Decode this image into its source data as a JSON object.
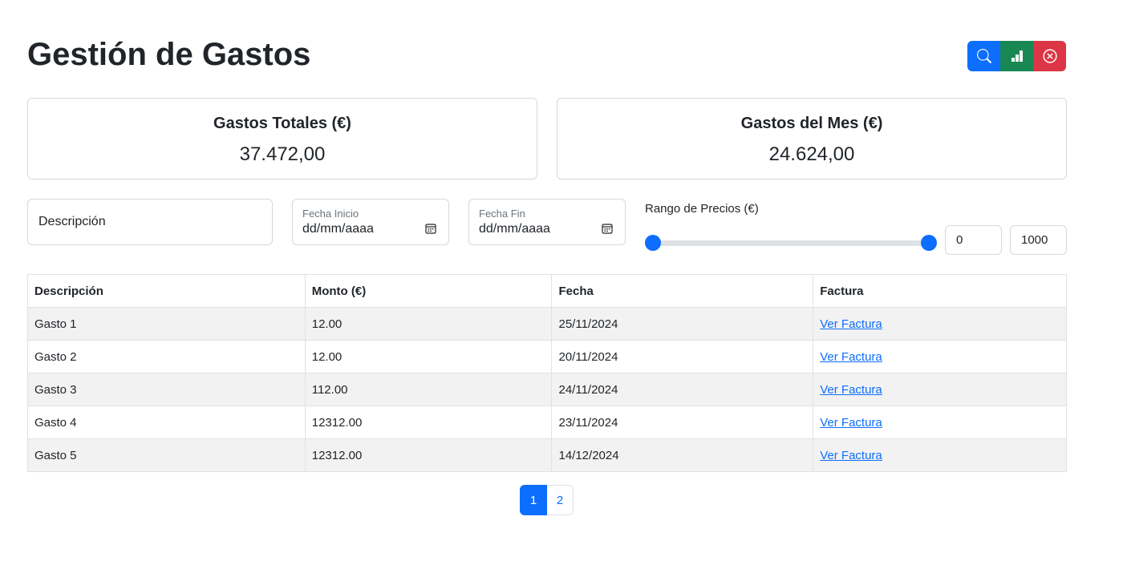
{
  "header": {
    "title": "Gestión de Gastos",
    "buttons": [
      {
        "icon": "search-icon",
        "color": "#0d6efd"
      },
      {
        "icon": "bar-chart-icon",
        "color": "#198754"
      },
      {
        "icon": "close-circle-icon",
        "color": "#dc3545"
      }
    ]
  },
  "summary": {
    "total": {
      "label": "Gastos Totales (€)",
      "value": "37.472,00"
    },
    "month": {
      "label": "Gastos del Mes (€)",
      "value": "24.624,00"
    }
  },
  "filters": {
    "description_placeholder": "Descripción",
    "start_date": {
      "label": "Fecha Inicio",
      "value": "dd/mm/aaaa"
    },
    "end_date": {
      "label": "Fecha Fin",
      "value": "dd/mm/aaaa"
    },
    "price_range": {
      "label": "Rango de Precios (€)",
      "min": "0",
      "max": "1000"
    }
  },
  "table": {
    "headers": [
      "Descripción",
      "Monto (€)",
      "Fecha",
      "Factura"
    ],
    "rows": [
      {
        "descripcion": "Gasto 1",
        "monto": "12.00",
        "fecha": "25/11/2024",
        "factura": "Ver Factura"
      },
      {
        "descripcion": "Gasto 2",
        "monto": "12.00",
        "fecha": "20/11/2024",
        "factura": "Ver Factura"
      },
      {
        "descripcion": "Gasto 3",
        "monto": "112.00",
        "fecha": "24/11/2024",
        "factura": "Ver Factura"
      },
      {
        "descripcion": "Gasto 4",
        "monto": "12312.00",
        "fecha": "23/11/2024",
        "factura": "Ver Factura"
      },
      {
        "descripcion": "Gasto 5",
        "monto": "12312.00",
        "fecha": "14/12/2024",
        "factura": "Ver Factura"
      }
    ]
  },
  "pagination": {
    "pages": [
      "1",
      "2"
    ],
    "active": "1"
  },
  "colors": {
    "primary": "#0d6efd",
    "success": "#198754",
    "danger": "#dc3545",
    "stripe": "#f2f2f2"
  }
}
